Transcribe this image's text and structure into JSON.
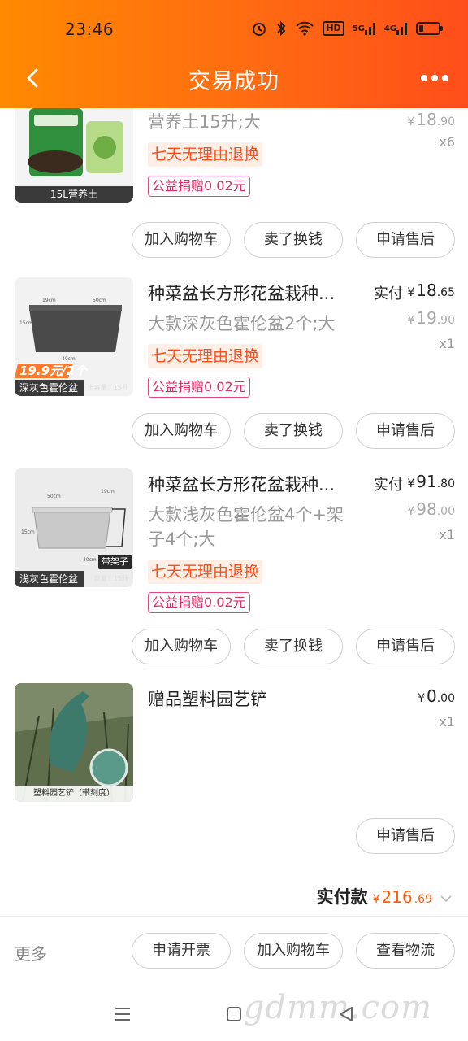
{
  "status_bar": {
    "time": "23:46",
    "hd": "HD",
    "net1": "5G",
    "net2": "4G"
  },
  "nav": {
    "title": "交易成功"
  },
  "items": [
    {
      "thumb_caption": "15L营养土",
      "name": "",
      "spec": "营养土15升;大",
      "return_tag": "七天无理由退换",
      "charity_tag": "公益捐赠0.02元",
      "paid_label": "",
      "paid_yen": "",
      "paid_int": "",
      "paid_dec": "",
      "orig_yen": "¥",
      "orig_int": "18",
      "orig_dec": ".90",
      "qty": "x6",
      "buttons": [
        "加入购物车",
        "卖了换钱",
        "申请售后"
      ]
    },
    {
      "thumb_caption": "深灰色霍伦盆",
      "thumb_caption_right": "土容量：15升",
      "price_badge": "19.9元/2个",
      "name": "种菜盆长方形花盆栽种...",
      "spec": "大款深灰色霍伦盆2个;大",
      "return_tag": "七天无理由退换",
      "charity_tag": "公益捐赠0.02元",
      "paid_label": "实付",
      "paid_yen": "¥",
      "paid_int": "18",
      "paid_dec": ".65",
      "orig_yen": "¥",
      "orig_int": "19",
      "orig_dec": ".90",
      "qty": "x1",
      "buttons": [
        "加入购物车",
        "卖了换钱",
        "申请售后"
      ]
    },
    {
      "thumb_caption": "浅灰色霍伦盆",
      "thumb_caption_right": "容量：15升",
      "thumb_badge": "带架子",
      "name": "种菜盆长方形花盆栽种...",
      "spec": "大款浅灰色霍伦盆4个+架子4个;大",
      "return_tag": "七天无理由退换",
      "charity_tag": "公益捐赠0.02元",
      "paid_label": "实付",
      "paid_yen": "¥",
      "paid_int": "91",
      "paid_dec": ".80",
      "orig_yen": "¥",
      "orig_int": "98",
      "orig_dec": ".00",
      "qty": "x1",
      "buttons": [
        "加入购物车",
        "卖了换钱",
        "申请售后"
      ]
    },
    {
      "thumb_caption": "塑料园艺铲（带刻度）",
      "name": "赠品塑料园艺铲",
      "paid_yen": "¥",
      "paid_int": "0",
      "paid_dec": ".00",
      "qty": "x1",
      "buttons": [
        "申请售后"
      ]
    }
  ],
  "total": {
    "label": "实付款",
    "yen": "¥",
    "int": "216",
    "dec": ".69"
  },
  "bottom_bar": {
    "more": "更多",
    "invoice": "申请开票",
    "add_cart": "加入购物车",
    "logistics": "查看物流"
  },
  "watermark": "gdmm.com",
  "colors": {
    "accent": "#ff5a0a",
    "header_start": "#ff8a00",
    "header_end": "#ff4e1a",
    "charity": "#d9306a"
  }
}
